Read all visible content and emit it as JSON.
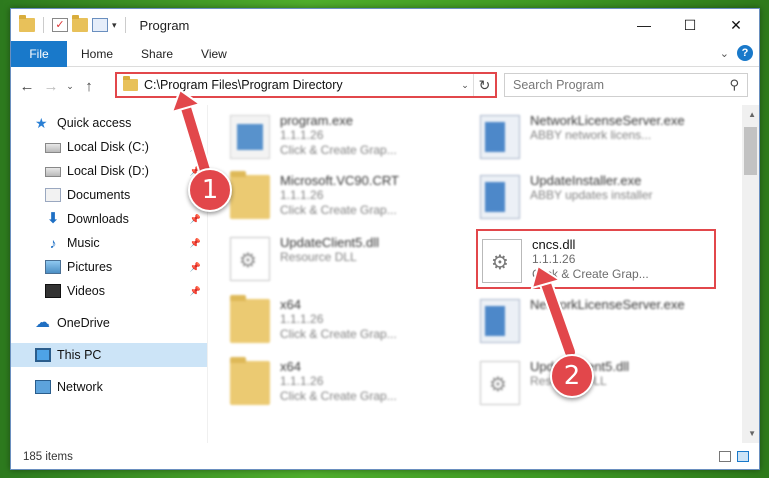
{
  "window": {
    "title": "Program",
    "controls": {
      "minimize": "—",
      "maximize": "☐",
      "close": "✕"
    }
  },
  "ribbon": {
    "tabs": [
      "File",
      "Home",
      "Share",
      "View"
    ],
    "help": "?",
    "collapse": "⌄"
  },
  "address": {
    "path": "C:\\Program Files\\Program Directory",
    "dropdown": "⌄",
    "refresh": "↻",
    "back": "←",
    "forward": "→",
    "recent": "⌄",
    "up": "↑"
  },
  "search": {
    "placeholder": "Search Program",
    "icon": "search-icon"
  },
  "sidebar": {
    "items": [
      {
        "label": "Quick access",
        "icon": "star-icon",
        "pinned": false
      },
      {
        "label": "Local Disk (C:)",
        "icon": "disk-icon",
        "pinned": true
      },
      {
        "label": "Local Disk (D:)",
        "icon": "disk-icon",
        "pinned": true
      },
      {
        "label": "Documents",
        "icon": "documents-icon",
        "pinned": true
      },
      {
        "label": "Downloads",
        "icon": "downloads-icon",
        "pinned": true
      },
      {
        "label": "Music",
        "icon": "music-icon",
        "pinned": true
      },
      {
        "label": "Pictures",
        "icon": "pictures-icon",
        "pinned": true
      },
      {
        "label": "Videos",
        "icon": "videos-icon",
        "pinned": true
      },
      {
        "label": "OneDrive",
        "icon": "cloud-icon",
        "pinned": false
      },
      {
        "label": "This PC",
        "icon": "pc-icon",
        "pinned": false,
        "selected": true
      },
      {
        "label": "Network",
        "icon": "network-icon",
        "pinned": false
      }
    ],
    "pin_glyph": "📌"
  },
  "files": [
    {
      "name": "program.exe",
      "line2": "1.1.1.26",
      "line3": "Click & Create Grap...",
      "type": "exe",
      "blurred": true
    },
    {
      "name": "NetworkLicenseServer.exe",
      "line2": "ABBY network licens...",
      "line3": "",
      "type": "app",
      "blurred": true
    },
    {
      "name": "Microsoft.VC90.CRT",
      "line2": "1.1.1.26",
      "line3": "Click & Create Grap...",
      "type": "folder",
      "blurred": true
    },
    {
      "name": "UpdateInstaller.exe",
      "line2": "ABBY updates installer",
      "line3": "",
      "type": "app",
      "blurred": true
    },
    {
      "name": "UpdateClient5.dll",
      "line2": "Resource DLL",
      "line3": "",
      "type": "dll",
      "blurred": true
    },
    {
      "name": "cncs.dll",
      "line2": "1.1.1.26",
      "line3": "Click & Create Grap...",
      "type": "dll",
      "blurred": false
    },
    {
      "name": "x64",
      "line2": "1.1.1.26",
      "line3": "Click & Create Grap...",
      "type": "folder",
      "blurred": true
    },
    {
      "name": "NetworkLicenseServer.exe",
      "line2": "",
      "line3": "",
      "type": "app",
      "blurred": true
    },
    {
      "name": "x64",
      "line2": "1.1.1.26",
      "line3": "Click & Create Grap...",
      "type": "folder",
      "blurred": true
    },
    {
      "name": "UpdateClient5.dll",
      "line2": "Resource DLL",
      "line3": "",
      "type": "dll",
      "blurred": true
    }
  ],
  "status": {
    "count": "185 items"
  },
  "annotations": {
    "step1": "1",
    "step2": "2"
  },
  "colors": {
    "accent": "#1979ca",
    "highlight": "#e2474b"
  }
}
